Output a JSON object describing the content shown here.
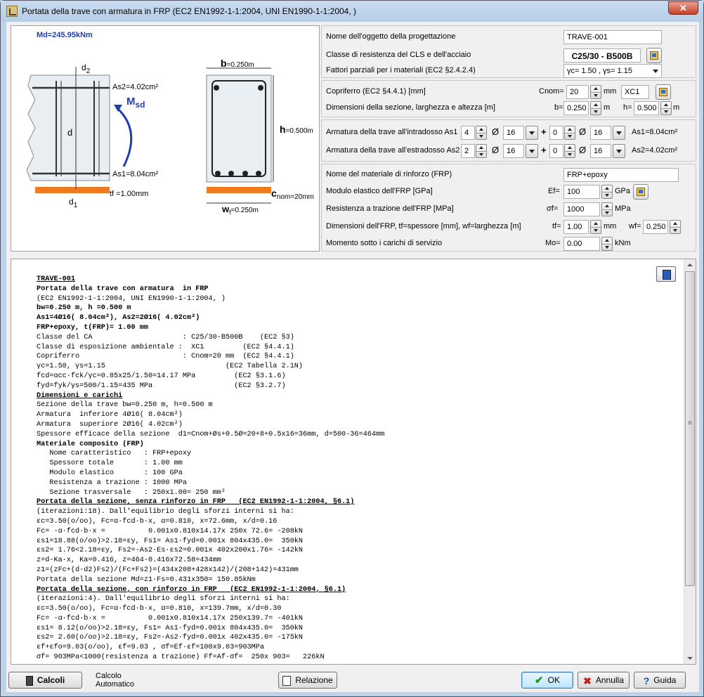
{
  "window": {
    "title": "Portata della trave con armatura  in FRP (EC2 EN1992-1-1:2004, UNI EN1990-1-1:2004, )",
    "close_label": "✕"
  },
  "diagram": {
    "md": "Md=245.95kNm",
    "d2": "d",
    "d2_sub": "2",
    "as2": "As2=4.02cm²",
    "msd": "M",
    "msd_sub": "sd",
    "d": "d",
    "as1": "As1=8.04cm²",
    "tf": "tf =1.00mm",
    "d1": "d",
    "d1_sub": "1",
    "b": "b",
    "b_val": "=0.250m",
    "h": "h",
    "h_val": "=0.500m",
    "cnom": "c",
    "cnom_sub": "nom=20mm",
    "wf": "w",
    "wf_sub": "f",
    "wf_val": "=0.250m"
  },
  "props": {
    "name_label": "Nome dell'oggetto della progettazione",
    "name_value": "TRAVE-001",
    "class_label": "Classe di resistenza del CLS e dell'acciaio",
    "class_value": "C25/30 - B500B",
    "factors_label": "Fattori parziali per i materiali (EC2 §2.4.2.4)",
    "factors_value": "γc=  1.50 , γs=  1.15",
    "cover_label": "Copriferro (EC2 §4.4.1) [mm]",
    "cnom_label": "Cnom=",
    "cnom_value": "20",
    "mm1": "mm",
    "exposure_value": "XC1",
    "dims_label": "Dimensioni della sezione, larghezza e altezza [m]",
    "b_label": "b=",
    "b_value": "0.250",
    "m1": "m",
    "h_label": "h=",
    "h_value": "0.500",
    "m2": "m",
    "as1_label": "Armatura della trave all'intradosso As1",
    "as1_n1": "4",
    "as1_d1": "16",
    "as1_n2": "0",
    "as1_d2": "16",
    "as1_result": "As1=8.04cm²",
    "as2_label": "Armatura della trave all'estradosso As2",
    "as2_n1": "2",
    "as2_d1": "16",
    "as2_n2": "0",
    "as2_d2": "16",
    "as2_result": "As2=4.02cm²",
    "phi": "Ø",
    "plus": "+",
    "frp_name_label": "Nome del materiale di rinforzo (FRP)",
    "frp_name_value": "FRP+epoxy",
    "ef_row_label": "Modulo elastico dell'FRP [GPa]",
    "ef_label": "Ef=",
    "ef_value": "100",
    "gpa": "GPa",
    "sf_row_label": "Resistenza  a trazione dell'FRP [MPa]",
    "sf_label": "σf=",
    "sf_value": "1000",
    "mpa": "MPa",
    "frp_dims_label": "Dimensioni dell'FRP, tf=spessore [mm], wf=larghezza [m]",
    "tf_label": "tf=",
    "tf_value": "1.00",
    "mm2": "mm",
    "wf_label": "wf=",
    "wf_value": "0.250",
    "mo_row_label": "Momento sotto i carichi di servizio",
    "mo_label": "Mo=",
    "mo_value": "0.00",
    "knm": "kNm"
  },
  "report": {
    "lines": [
      {
        "t": "TRAVE-001",
        "s": "hd"
      },
      {
        "t": "Portata della trave con armatura  in FRP",
        "s": "b"
      },
      {
        "t": "(EC2 EN1992-1-1:2004, UNI EN1990-1-1:2004, )",
        "s": ""
      },
      {
        "t": "bw=0.250 m, h =0.500 m",
        "s": "b"
      },
      {
        "t": "As1=4Ø16( 8.04cm²), As2=2Ø16( 4.02cm²)",
        "s": "b"
      },
      {
        "t": "FRP+epoxy, t(FRP)= 1.00 mm",
        "s": "b"
      },
      {
        "t": "Classe del CA                     : C25/30-B500B    (EC2 §3)",
        "s": ""
      },
      {
        "t": "Classe di esposizione ambientale :  XC1         (EC2 §4.4.1)",
        "s": ""
      },
      {
        "t": "Copriferro                        : Cnom=20 mm  (EC2 §4.4.1)",
        "s": ""
      },
      {
        "t": "γc=1.50, γs=1.15                            (EC2 Tabella 2.1N)",
        "s": ""
      },
      {
        "t": "fcd=αcc·fck/γc=0.85x25/1.50=14.17 MPa         (EC2 §3.1.6)",
        "s": ""
      },
      {
        "t": "fyd=fyk/γs=500/1.15=435 MPa                   (EC2 §3.2.7)",
        "s": ""
      },
      {
        "t": "Dimensioni e carichi",
        "s": "hd"
      },
      {
        "t": "Sezione della trave bw=0.250 m, h=0.500 m",
        "s": ""
      },
      {
        "t": "Armatura  inferiore 4Ø16( 8.04cm²)",
        "s": ""
      },
      {
        "t": "Armatura  superiore 2Ø16( 4.02cm²)",
        "s": ""
      },
      {
        "t": "Spessore efficace della sezione  d1=Cnom+Øs+0.5Ø=20+8+0.5x16=36mm, d=500-36=464mm",
        "s": ""
      },
      {
        "t": "Materiale composito (FRP)",
        "s": "b"
      },
      {
        "t": "   Nome caratteristico   : FRP+epoxy",
        "s": ""
      },
      {
        "t": "   Spessore totale       : 1.00 mm",
        "s": ""
      },
      {
        "t": "   Modulo elastico       : 100 GPa",
        "s": ""
      },
      {
        "t": "   Resistenza a trazione : 1000 MPa",
        "s": ""
      },
      {
        "t": "   Sezione trasversale   : 250x1.00= 250 mm²",
        "s": ""
      },
      {
        "t": "Portata della sezione, senza rinforzo in FRP   (EC2 EN1992-1-1:2004, §6.1)",
        "s": "hd"
      },
      {
        "t": "(iterazioni:18). Dall'equilibrio degli sforzi interni si ha:",
        "s": ""
      },
      {
        "t": "εc=3.50(o/oo), Fc=α·fcd·b·x, α=0.810, x=72.6mm, x/d=0.16",
        "s": ""
      },
      {
        "t": "Fc= -α·fcd·b·x =          0.001x0.810x14.17x 250x 72.6= -208kN",
        "s": ""
      },
      {
        "t": "εs1=18.88(o/oo)>2.18=εy, Fs1= As1·fyd=0.001x 804x435.0=  350kN",
        "s": ""
      },
      {
        "t": "εs2= 1.76<2.18=εy, Fs2=-As2·Es·εs2=0.001x 402x200x1.76= -142kN",
        "s": ""
      },
      {
        "t": "z=d-Ka·x, Ka=0.416, z=464-0.416x72.58=434mm",
        "s": ""
      },
      {
        "t": "z1=(zFc+(d-d2)Fs2)/(Fc+Fs2)=(434x208+428x142)/(208+142)=431mm",
        "s": ""
      },
      {
        "t": "Portata della sezione Md=z1·Fs=0.431x350= 150.85kNm",
        "s": ""
      },
      {
        "t": "Portata della sezione, con rinforzo in FRP   (EC2 EN1992-1-1:2004, §6.1)",
        "s": "hd"
      },
      {
        "t": "(iterazioni:4). Dall'equilibrio degli sforzi interni si ha:",
        "s": ""
      },
      {
        "t": "εc=3.50(o/oo), Fc=α·fcd·b·x, α=0.810, x=139.7mm, x/d=0.30",
        "s": ""
      },
      {
        "t": "Fc= -α·fcd·b·x =          0.001x0.810x14.17x 250x139.7= -401kN",
        "s": ""
      },
      {
        "t": "εs1= 8.12(o/oo)>2.18=εy, Fs1= As1·fyd=0.001x 804x435.0=  350kN",
        "s": ""
      },
      {
        "t": "εs2= 2.60(o/oo)>2.18=εy, Fs2=-As2·fyd=0.001x 402x435.0= -175kN",
        "s": ""
      },
      {
        "t": "εf+εfo=9.03(o/oo), εf=9.03 , σf=Ef·εf=100x9.03=903MPa",
        "s": ""
      },
      {
        "t": "σf= 903MPa<1000(resistenza a trazione) Ff=Af·σf=  250x 903=   226kN",
        "s": ""
      }
    ]
  },
  "bottom": {
    "calcoli": "Calcoli",
    "calc_mode_1": "Calcolo",
    "calc_mode_2": "Automatico",
    "relazione": "Relazione",
    "ok": "OK",
    "annulla": "Annulla",
    "guida": "Guida"
  }
}
